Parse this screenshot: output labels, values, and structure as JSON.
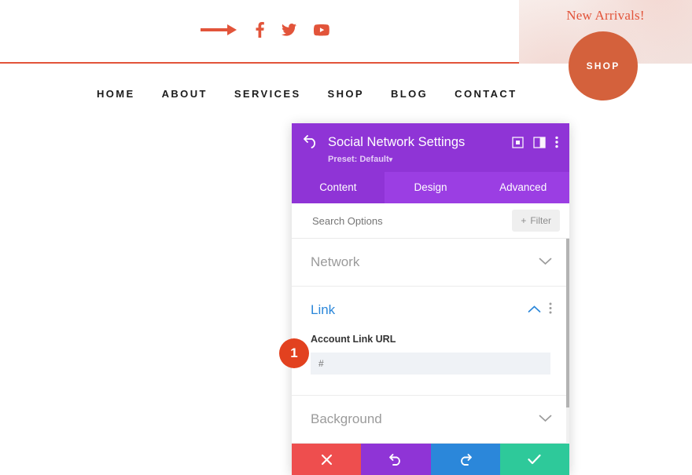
{
  "site": {
    "social_icons": [
      "arrow-annotation",
      "facebook-icon",
      "twitter-icon",
      "youtube-icon"
    ],
    "promo_text": "New Arrivals!",
    "shop_button": "SHOP",
    "accent_color": "#e2543a",
    "nav": [
      {
        "label": "HOME"
      },
      {
        "label": "ABOUT"
      },
      {
        "label": "SERVICES"
      },
      {
        "label": "SHOP"
      },
      {
        "label": "BLOG"
      },
      {
        "label": "CONTACT"
      }
    ]
  },
  "modal": {
    "title": "Social Network Settings",
    "preset": "Preset: Default",
    "preset_caret": "▾",
    "header_color": "#8f34d6",
    "tabs": [
      {
        "label": "Content",
        "active": true
      },
      {
        "label": "Design",
        "active": false
      },
      {
        "label": "Advanced",
        "active": false
      }
    ],
    "search": {
      "placeholder": "Search Options",
      "value": ""
    },
    "filter_label": "Filter",
    "filter_plus": "+",
    "sections": [
      {
        "title": "Network",
        "open": false
      },
      {
        "title": "Link",
        "open": true
      },
      {
        "title": "Background",
        "open": false
      }
    ],
    "link_field": {
      "label": "Account Link URL",
      "value": "",
      "placeholder": "#"
    },
    "footer": [
      {
        "name": "cancel",
        "glyph": "✖",
        "color": "#ee4e4e"
      },
      {
        "name": "undo",
        "glyph": "↺",
        "color": "#8f34d6"
      },
      {
        "name": "redo",
        "glyph": "↻",
        "color": "#2b87da"
      },
      {
        "name": "save",
        "glyph": "✔",
        "color": "#2ec99a"
      }
    ]
  },
  "annotation": {
    "step_number": "1",
    "badge_color": "#e2411f"
  }
}
